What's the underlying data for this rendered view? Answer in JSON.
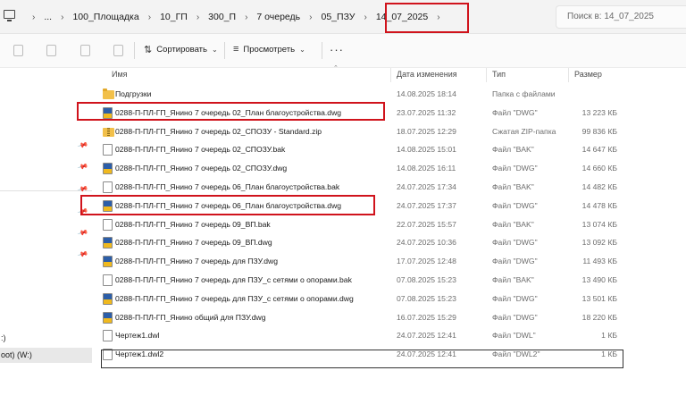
{
  "address_bar": {
    "ellipsis": "...",
    "crumbs": [
      "100_Площадка",
      "10_ГП",
      "300_П",
      "7 очередь",
      "05_ПЗУ"
    ],
    "current": "14_07_2025",
    "search_placeholder": "Поиск в: 14_07_2025"
  },
  "toolbar": {
    "sort_label": "Сортировать",
    "view_label": "Просмотреть",
    "more_label": "···"
  },
  "nav": {
    "items": [
      ":)",
      "oot) (W:)"
    ]
  },
  "columns": {
    "name": "Имя",
    "date": "Дата изменения",
    "type": "Тип",
    "size": "Размер"
  },
  "files": [
    {
      "name": "Подгрузки",
      "date": "14.08.2025 18:14",
      "type": "Папка с файлами",
      "size": "",
      "icon": "folder-icon"
    },
    {
      "name": "0288-П-ПЛ-ГП_Янино 7 очередь 02_План благоустройства.dwg",
      "date": "23.07.2025 11:32",
      "type": "Файл \"DWG\"",
      "size": "13 223 КБ",
      "icon": "dwg-file-icon"
    },
    {
      "name": "0288-П-ПЛ-ГП_Янино 7 очередь 02_СПОЗУ - Standard.zip",
      "date": "18.07.2025 12:29",
      "type": "Сжатая ZIP-папка",
      "size": "99 836 КБ",
      "icon": "zip-folder-icon"
    },
    {
      "name": "0288-П-ПЛ-ГП_Янино 7 очередь 02_СПОЗУ.bak",
      "date": "14.08.2025 15:01",
      "type": "Файл \"BAK\"",
      "size": "14 647 КБ",
      "icon": "document-icon"
    },
    {
      "name": "0288-П-ПЛ-ГП_Янино 7 очередь 02_СПОЗУ.dwg",
      "date": "14.08.2025 16:11",
      "type": "Файл \"DWG\"",
      "size": "14 660 КБ",
      "icon": "dwg-file-icon"
    },
    {
      "name": "0288-П-ПЛ-ГП_Янино 7 очередь 06_План благоустройства.bak",
      "date": "24.07.2025 17:34",
      "type": "Файл \"BAK\"",
      "size": "14 482 КБ",
      "icon": "document-icon"
    },
    {
      "name": "0288-П-ПЛ-ГП_Янино 7 очередь 06_План благоустройства.dwg",
      "date": "24.07.2025 17:37",
      "type": "Файл \"DWG\"",
      "size": "14 478 КБ",
      "icon": "dwg-file-icon"
    },
    {
      "name": "0288-П-ПЛ-ГП_Янино 7 очередь 09_ВП.bak",
      "date": "22.07.2025 15:57",
      "type": "Файл \"BAK\"",
      "size": "13 074 КБ",
      "icon": "document-icon"
    },
    {
      "name": "0288-П-ПЛ-ГП_Янино 7 очередь 09_ВП.dwg",
      "date": "24.07.2025 10:36",
      "type": "Файл \"DWG\"",
      "size": "13 092 КБ",
      "icon": "dwg-file-icon"
    },
    {
      "name": "0288-П-ПЛ-ГП_Янино 7 очередь для ПЗУ.dwg",
      "date": "17.07.2025 12:48",
      "type": "Файл \"DWG\"",
      "size": "11 493 КБ",
      "icon": "dwg-file-icon"
    },
    {
      "name": "0288-П-ПЛ-ГП_Янино 7 очередь для ПЗУ_с сетями о опорами.bak",
      "date": "07.08.2025 15:23",
      "type": "Файл \"BAK\"",
      "size": "13 490 КБ",
      "icon": "document-icon"
    },
    {
      "name": "0288-П-ПЛ-ГП_Янино 7 очередь для ПЗУ_с сетями о опорами.dwg",
      "date": "07.08.2025 15:23",
      "type": "Файл \"DWG\"",
      "size": "13 501 КБ",
      "icon": "dwg-file-icon"
    },
    {
      "name": "0288-П-ПЛ-ГП_Янино общий для ПЗУ.dwg",
      "date": "16.07.2025 15:29",
      "type": "Файл \"DWG\"",
      "size": "18 220 КБ",
      "icon": "dwg-file-icon"
    },
    {
      "name": "Чертеж1.dwl",
      "date": "24.07.2025 12:41",
      "type": "Файл \"DWL\"",
      "size": "1 КБ",
      "icon": "document-icon"
    },
    {
      "name": "Чертеж1.dwl2",
      "date": "24.07.2025 12:41",
      "type": "Файл \"DWL2\"",
      "size": "1 КБ",
      "icon": "document-icon"
    }
  ],
  "colors": {
    "highlight_box": "#d0131c",
    "selected_nav": "#e8e8e8"
  }
}
